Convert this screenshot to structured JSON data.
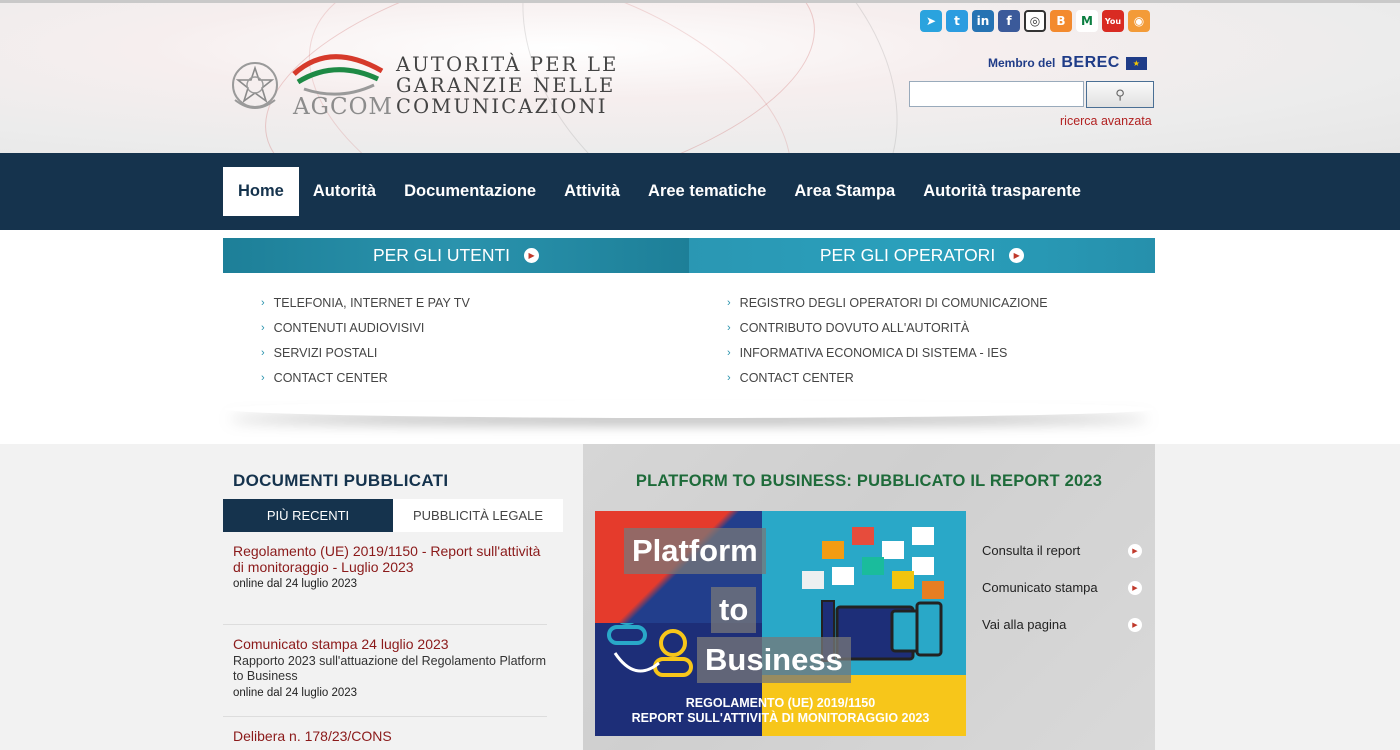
{
  "header": {
    "agcom_label": "AGCOM",
    "org_name_lines": [
      "AUTORITÀ PER LE",
      "GARANZIE NELLE",
      "COMUNICAZIONI"
    ],
    "berec_prefix": "Membro del",
    "berec_logo": "BEREC",
    "search_button_icon": "search-icon",
    "advanced_search": "ricerca avanzata",
    "social_icons": [
      "telegram-icon",
      "twitter-icon",
      "linkedin-icon",
      "facebook-icon",
      "instagram-icon",
      "blogger-icon",
      "medium-icon",
      "youtube-icon",
      "rss-icon"
    ]
  },
  "nav": {
    "items": [
      "Home",
      "Autorità",
      "Documentazione",
      "Attività",
      "Aree tematiche",
      "Area Stampa",
      "Autorità trasparente"
    ]
  },
  "users_panel": {
    "title": "PER GLI UTENTI",
    "items": [
      "TELEFONIA, INTERNET E PAY TV",
      "CONTENUTI AUDIOVISIVI",
      "SERVIZI POSTALI",
      "CONTACT CENTER"
    ]
  },
  "operators_panel": {
    "title": "PER GLI OPERATORI",
    "items": [
      "REGISTRO DEGLI OPERATORI DI COMUNICAZIONE",
      "CONTRIBUTO DOVUTO ALL'AUTORITÀ",
      "INFORMATIVA ECONOMICA DI SISTEMA - IES",
      "CONTACT CENTER"
    ]
  },
  "documents": {
    "title": "DOCUMENTI PUBBLICATI",
    "tabs": [
      "PIÙ RECENTI",
      "PUBBLICITÀ LEGALE"
    ],
    "items": [
      {
        "title": "Regolamento (UE) 2019/1150 - Report sull'attività di monitoraggio - Luglio 2023",
        "description": "",
        "date": "online dal 24 luglio 2023"
      },
      {
        "title": "Comunicato stampa 24 luglio 2023",
        "description": "Rapporto 2023 sull'attuazione del Regolamento Platform to Business",
        "date": "online dal 24 luglio 2023"
      },
      {
        "title": "Delibera n. 178/23/CONS",
        "description": "",
        "date": ""
      }
    ]
  },
  "feature": {
    "title": "PLATFORM TO BUSINESS: PUBBLICATO IL REPORT 2023",
    "promo_words": [
      "Platform",
      "to",
      "Business"
    ],
    "promo_subtitle_lines": [
      "REGOLAMENTO (UE) 2019/1150",
      "REPORT SULL'ATTIVITÀ DI MONITORAGGIO 2023"
    ],
    "links": [
      "Consulta il report",
      "Comunicato stampa",
      "Vai alla pagina"
    ]
  },
  "colors": {
    "nav_bg": "#15334d",
    "panel_teal": "#2a93ad",
    "doc_title_red": "#8b1a1a",
    "feature_title_green": "#1e6b3a"
  }
}
